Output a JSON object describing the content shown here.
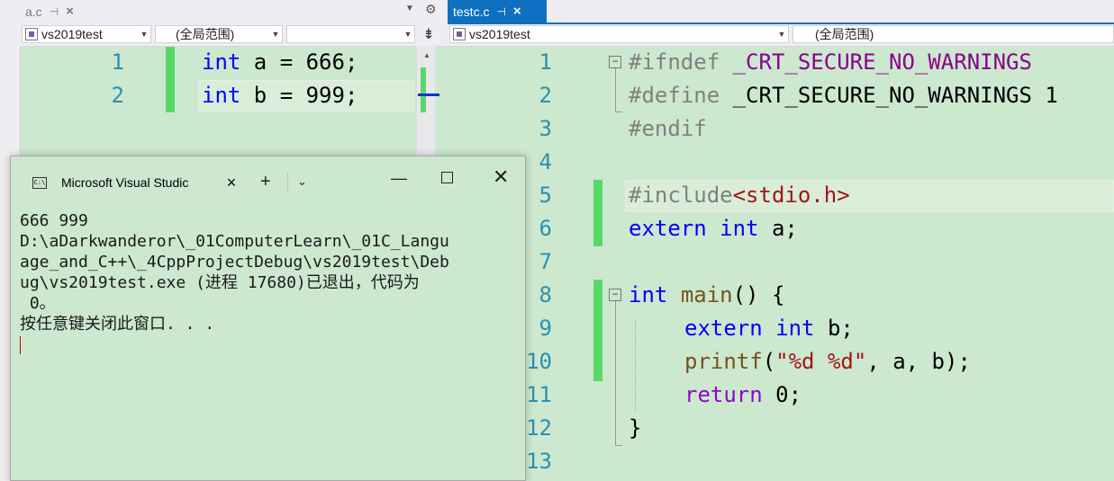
{
  "left_editor": {
    "tab_label": "a.c",
    "project_dropdown": "vs2019test",
    "scope_dropdown": "(全局范围)",
    "member_dropdown": "",
    "line_numbers": [
      "1",
      "2"
    ],
    "lines": [
      {
        "kw": "int",
        "rest": " a = 666;"
      },
      {
        "kw": "int",
        "rest": " b = 999;"
      }
    ]
  },
  "right_editor": {
    "tab_label": "testc.c",
    "project_dropdown": "vs2019test",
    "scope_dropdown": "(全局范围)",
    "line_numbers": [
      "1",
      "2",
      "3",
      "4",
      "5",
      "6",
      "7",
      "8",
      "9",
      "10",
      "11",
      "12",
      "13"
    ],
    "code": {
      "l1_pp": "#ifndef",
      "l1_macro": " _CRT_SECURE_NO_WARNINGS",
      "l2_pp": "#define",
      "l2_rest": " _CRT_SECURE_NO_WARNINGS 1",
      "l3_pp": "#endif",
      "l5_pp": "#include",
      "l5_str": "<stdio.h>",
      "l6_kw1": "extern",
      "l6_kw2": "int",
      "l6_rest": " a;",
      "l8_kw": "int",
      "l8_fn": "main",
      "l8_rest": "() {",
      "l9_kw1": "extern",
      "l9_kw2": "int",
      "l9_rest": " b;",
      "l10_fn": "printf",
      "l10_p1": "(",
      "l10_str": "\"%d %d\"",
      "l10_rest": ", a, b);",
      "l11_kw": "return",
      "l11_rest": " 0;",
      "l12": "}"
    }
  },
  "console": {
    "title": "Microsoft Visual Studic",
    "icon_label": "C:\\",
    "output_lines": [
      "666 999",
      "D:\\aDarkwanderor\\_01ComputerLearn\\_01C_Langu",
      "age_and_C++\\_4CppProjectDebug\\vs2019test\\Deb",
      "ug\\vs2019test.exe (进程 17680)已退出，代码为",
      " 0。",
      "按任意键关闭此窗口. . ."
    ]
  },
  "colors": {
    "background": "#cce8cf",
    "active_tab": "#0e70c0",
    "keyword": "#0000ff",
    "preprocessor": "#808080",
    "macro": "#8b008b",
    "string": "#a31515",
    "function": "#74531f",
    "control_keyword": "#8f08c4",
    "line_number": "#2b91af",
    "change_bar": "#59d86a"
  }
}
